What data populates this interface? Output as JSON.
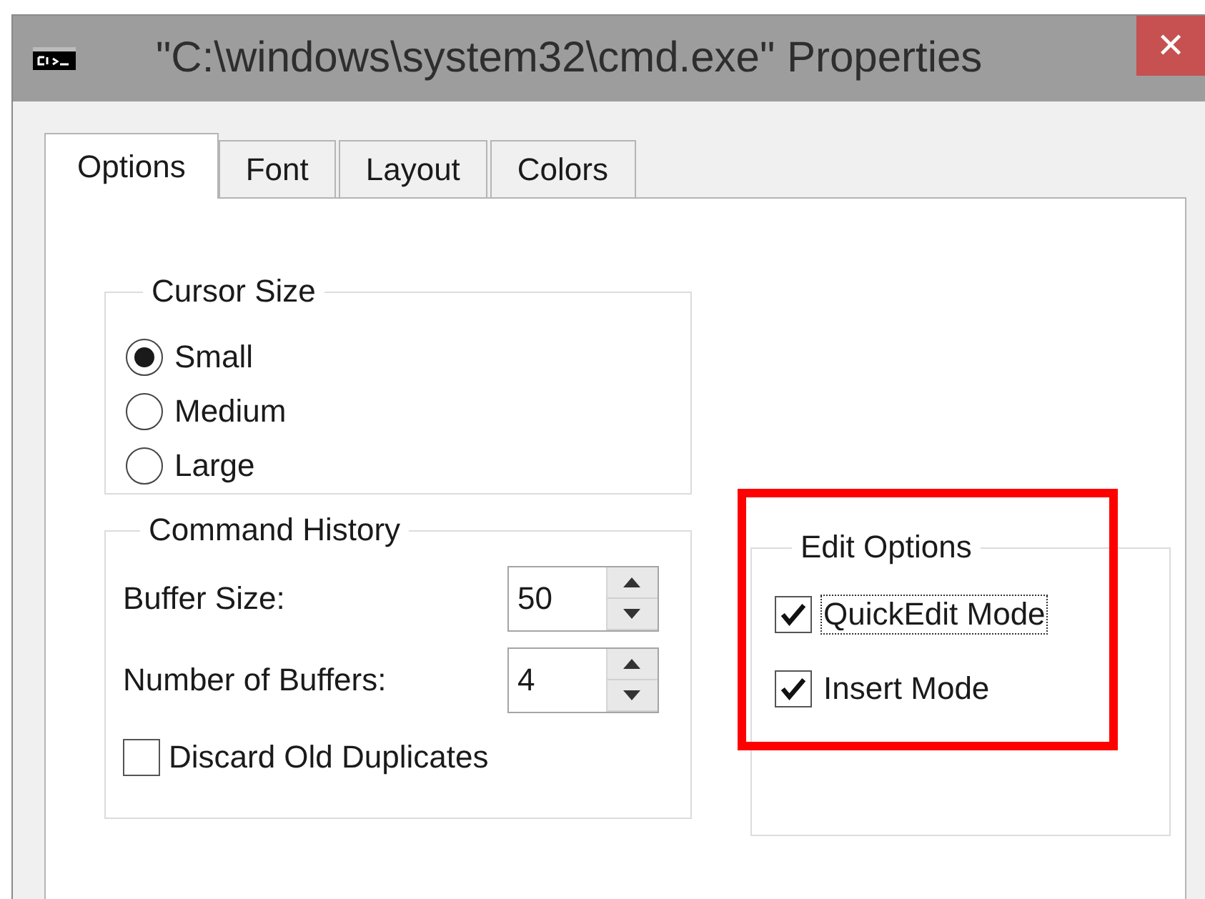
{
  "window": {
    "title": "\"C:\\windows\\system32\\cmd.exe\" Properties",
    "close": "✕"
  },
  "tabs": [
    {
      "label": "Options",
      "selected": true
    },
    {
      "label": "Font",
      "selected": false
    },
    {
      "label": "Layout",
      "selected": false
    },
    {
      "label": "Colors",
      "selected": false
    }
  ],
  "cursor_size": {
    "title": "Cursor Size",
    "options": [
      {
        "label": "Small",
        "selected": true
      },
      {
        "label": "Medium",
        "selected": false
      },
      {
        "label": "Large",
        "selected": false
      }
    ]
  },
  "command_history": {
    "title": "Command History",
    "fields": [
      {
        "label": "Buffer Size:",
        "value": "50"
      },
      {
        "label": "Number of Buffers:",
        "value": "4"
      }
    ],
    "discard": {
      "label": "Discard Old Duplicates",
      "checked": false
    }
  },
  "edit_options": {
    "title": "Edit Options",
    "highlighted": true,
    "options": [
      {
        "label": "QuickEdit Mode",
        "checked": true,
        "focused": true
      },
      {
        "label": "Insert Mode",
        "checked": true,
        "focused": false
      }
    ]
  }
}
